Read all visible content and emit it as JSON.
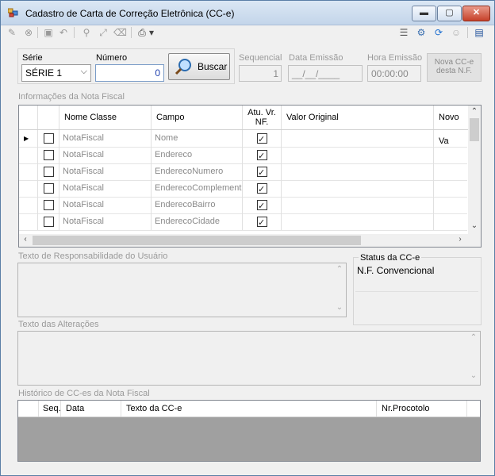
{
  "window": {
    "title": "Cadastro de Carta de Correção Eletrônica (CC-e)",
    "minimize": "▬",
    "maximize": "▢",
    "close": "✕"
  },
  "toolbar": {
    "left_icons": [
      "edit-icon",
      "cancel-icon",
      "save-icon",
      "undo-icon",
      "search-icon",
      "expand-icon",
      "eraser-icon",
      "printer-icon"
    ],
    "right_icons": [
      "list-icon",
      "settings-icon",
      "refresh-icon",
      "user-icon",
      "panel-icon"
    ],
    "dropdown_glyph": "▾"
  },
  "search": {
    "serie_label": "Série",
    "serie_value": "SÉRIE 1",
    "numero_label": "Número",
    "numero_value": "0",
    "buscar_label": "Buscar"
  },
  "info": {
    "sequencial_label": "Sequencial",
    "sequencial_value": "1",
    "data_label": "Data Emissão",
    "data_value": "__/__/____",
    "hora_label": "Hora Emissão",
    "hora_value": "00:00:00",
    "nova_label_1": "Nova CC-e",
    "nova_label_2": "desta N.F."
  },
  "nota": {
    "section_label": "Informações da Nota Fiscal",
    "columns": {
      "nome_classe": "Nome Classe",
      "campo": "Campo",
      "atu_1": "Atu. Vr.",
      "atu_2": "NF.",
      "valor_original": "Valor Original",
      "novo_valor": "Novo Va"
    },
    "rows": [
      {
        "classe": "NotaFiscal",
        "campo": "Nome",
        "selected": false,
        "atu": true
      },
      {
        "classe": "NotaFiscal",
        "campo": "Endereco",
        "selected": false,
        "atu": true
      },
      {
        "classe": "NotaFiscal",
        "campo": "EnderecoNumero",
        "selected": false,
        "atu": true
      },
      {
        "classe": "NotaFiscal",
        "campo": "EnderecoComplemento",
        "selected": false,
        "atu": true
      },
      {
        "classe": "NotaFiscal",
        "campo": "EnderecoBairro",
        "selected": false,
        "atu": true
      },
      {
        "classe": "NotaFiscal",
        "campo": "EnderecoCidade",
        "selected": false,
        "atu": true
      }
    ]
  },
  "responsabilidade": {
    "label": "Texto de Responsabilidade do Usuário"
  },
  "status": {
    "label": "Status da CC-e",
    "value": "N.F. Convencional"
  },
  "alteracoes": {
    "label": "Texto das Alterações"
  },
  "historico": {
    "label": "Histórico de CC-es da Nota Fiscal",
    "columns": {
      "seq": "Seq.",
      "data": "Data",
      "texto": "Texto da CC-e",
      "protocolo": "Nr.Procotolo"
    }
  },
  "colors": {
    "title_gradient_top": "#dbe7f4",
    "window_bg": "#f0f0f0",
    "accent": "#1e6fd0",
    "grid_empty": "#a0a0a0"
  }
}
